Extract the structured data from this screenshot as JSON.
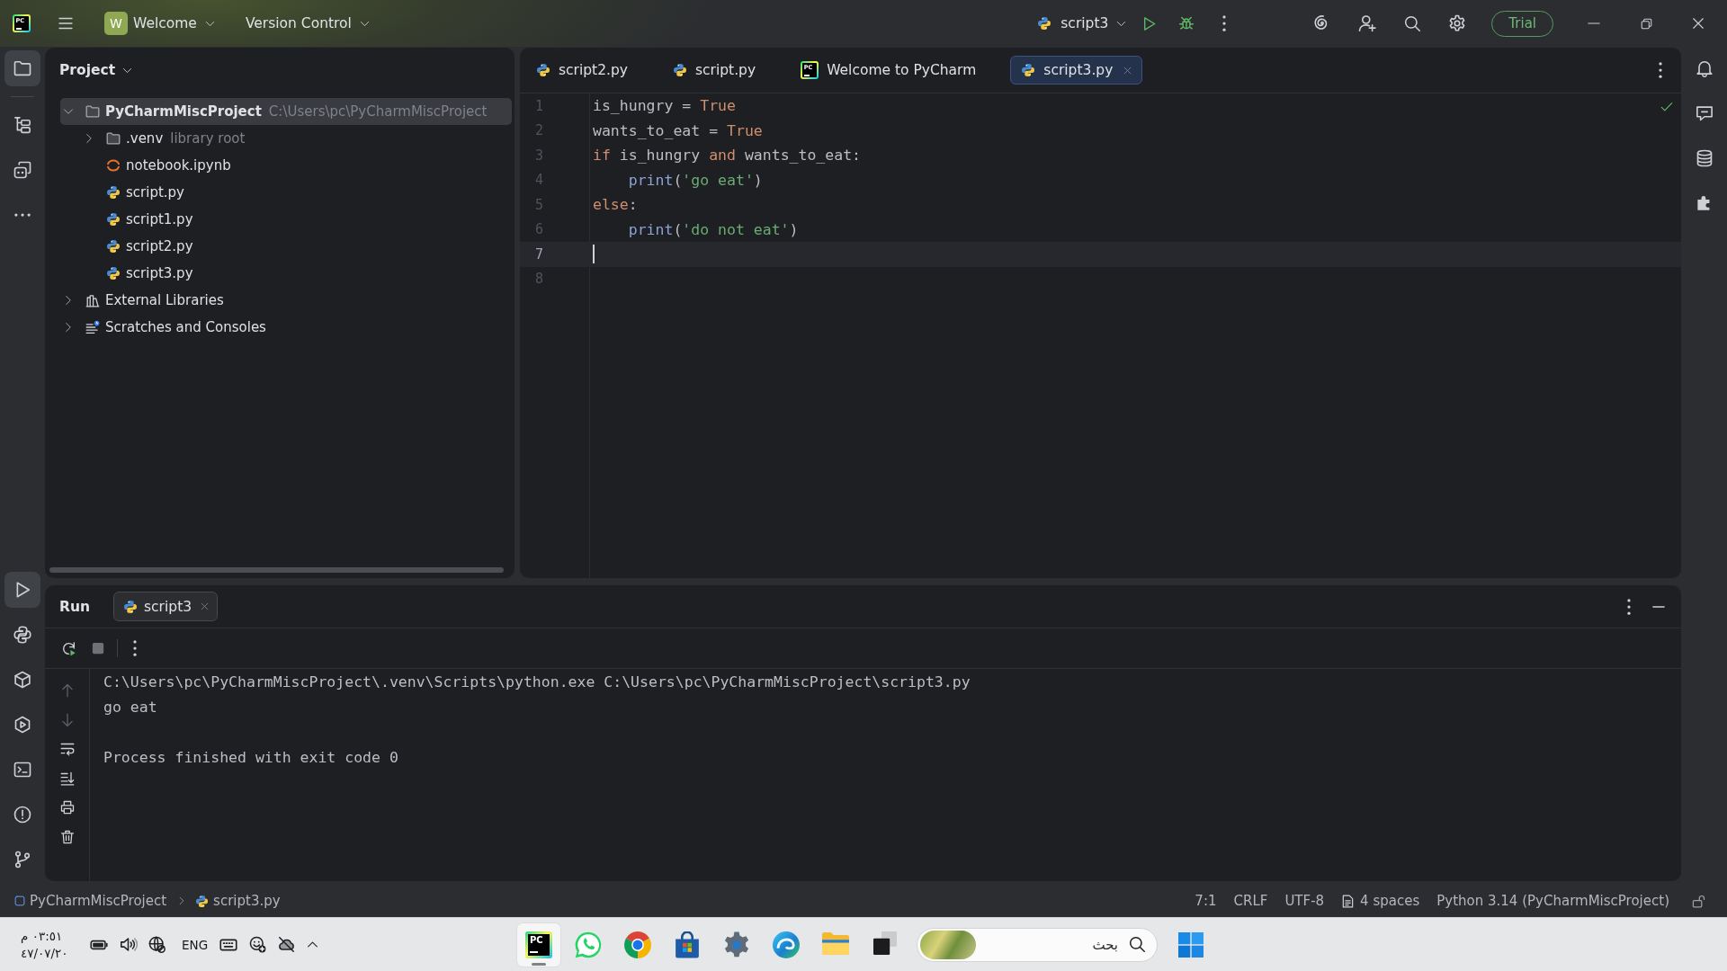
{
  "title_bar": {
    "logo": "PC",
    "project_badge": "W",
    "project": "Welcome",
    "vcs": "Version Control",
    "run_config": "script3",
    "trial": "Trial"
  },
  "tool_strip_left": {
    "top": [
      {
        "kind": "folder",
        "selected": true
      },
      {
        "kind": "structure",
        "selected": false
      },
      {
        "kind": "bot",
        "selected": false
      },
      {
        "kind": "more",
        "selected": false
      }
    ],
    "bottom": [
      {
        "kind": "run",
        "selected": true
      },
      {
        "kind": "python",
        "selected": false
      },
      {
        "kind": "packages",
        "selected": false
      },
      {
        "kind": "services",
        "selected": false
      },
      {
        "kind": "terminal",
        "selected": false
      },
      {
        "kind": "problems",
        "selected": false
      },
      {
        "kind": "git",
        "selected": false
      }
    ]
  },
  "project_panel": {
    "title": "Project",
    "tree": [
      {
        "kind": "folder",
        "label": "PyCharmMiscProject",
        "hint": "C:\\Users\\pc\\PyCharmMiscProject",
        "expanded": true,
        "selected": true,
        "children": [
          {
            "kind": "folder",
            "label": ".venv",
            "hint": "library root",
            "expanded": false,
            "selected": false
          },
          {
            "kind": "notebook",
            "label": "notebook.ipynb",
            "selected": false
          },
          {
            "kind": "python",
            "label": "script.py",
            "selected": false
          },
          {
            "kind": "python",
            "label": "script1.py",
            "selected": false
          },
          {
            "kind": "python",
            "label": "script2.py",
            "selected": false
          },
          {
            "kind": "python",
            "label": "script3.py",
            "selected": false
          }
        ]
      },
      {
        "kind": "libraries",
        "label": "External Libraries",
        "expanded": false,
        "selected": false
      },
      {
        "kind": "scratches",
        "label": "Scratches and Consoles",
        "expanded": false,
        "selected": false
      }
    ]
  },
  "editor": {
    "tabs": [
      {
        "kind": "python",
        "label": "script2.py",
        "selected": false
      },
      {
        "kind": "python",
        "label": "script.py",
        "selected": false
      },
      {
        "kind": "welcome",
        "logo": "PC",
        "label": "Welcome to PyCharm",
        "selected": false
      },
      {
        "kind": "python",
        "label": "script3.py",
        "selected": true
      }
    ],
    "lines": [
      {
        "number": "1",
        "current": false,
        "tokens": [
          {
            "kind": "plain",
            "text": "is_hungry = "
          },
          {
            "kind": "keyword",
            "text": "True"
          }
        ]
      },
      {
        "number": "2",
        "current": false,
        "tokens": [
          {
            "kind": "plain",
            "text": "wants_to_eat = "
          },
          {
            "kind": "keyword",
            "text": "True"
          }
        ]
      },
      {
        "number": "3",
        "current": false,
        "tokens": [
          {
            "kind": "keyword",
            "text": "if"
          },
          {
            "kind": "plain",
            "text": " is_hungry "
          },
          {
            "kind": "keyword",
            "text": "and"
          },
          {
            "kind": "plain",
            "text": " wants_to_eat:"
          }
        ]
      },
      {
        "number": "4",
        "current": false,
        "tokens": [
          {
            "kind": "builtin",
            "text": "    print"
          },
          {
            "kind": "plain",
            "text": "("
          },
          {
            "kind": "string",
            "text": "'go eat'"
          },
          {
            "kind": "plain",
            "text": ")"
          }
        ]
      },
      {
        "number": "5",
        "current": false,
        "tokens": [
          {
            "kind": "keyword",
            "text": "else"
          },
          {
            "kind": "plain",
            "text": ":"
          }
        ]
      },
      {
        "number": "6",
        "current": false,
        "tokens": [
          {
            "kind": "builtin",
            "text": "    print"
          },
          {
            "kind": "plain",
            "text": "("
          },
          {
            "kind": "string",
            "text": "'do not eat'"
          },
          {
            "kind": "plain",
            "text": ")"
          }
        ]
      },
      {
        "number": "7",
        "current": true
      },
      {
        "number": "8",
        "current": false
      }
    ]
  },
  "run_panel": {
    "title": "Run",
    "tabs": [
      {
        "label": "script3",
        "selected": true
      }
    ],
    "output": [
      {
        "kind": "text",
        "text": "C:\\Users\\pc\\PyCharmMiscProject\\.venv\\Scripts\\python.exe C:\\Users\\pc\\PyCharmMiscProject\\script3.py"
      },
      {
        "kind": "text",
        "text": "go eat"
      },
      {
        "kind": "status",
        "text": "Process finished with exit code 0"
      }
    ]
  },
  "status_bar": {
    "breadcrumbs": [
      {
        "kind": "project",
        "label": "PyCharmMiscProject"
      },
      {
        "kind": "python",
        "label": "script3.py"
      }
    ],
    "items": [
      {
        "kind": "text",
        "label": "7:1"
      },
      {
        "kind": "text",
        "label": "CRLF"
      },
      {
        "kind": "text",
        "label": "UTF-8"
      },
      {
        "kind": "indent",
        "label": "4 spaces"
      },
      {
        "kind": "text",
        "label": "Python 3.14 (PyCharmMiscProject)"
      }
    ]
  },
  "taskbar": {
    "time": "٠٣:٥١ م",
    "date": "٤٧/٠٧/٢٠",
    "language": "ENG",
    "apps": [
      {
        "kind": "pycharm",
        "logo": "PC",
        "running": true
      },
      {
        "kind": "whatsapp",
        "running": false
      },
      {
        "kind": "chrome",
        "running": false
      },
      {
        "kind": "store",
        "running": false
      },
      {
        "kind": "settings",
        "running": false
      },
      {
        "kind": "edge",
        "running": false
      },
      {
        "kind": "explorer",
        "running": false
      },
      {
        "kind": "window",
        "running": false
      }
    ],
    "search": {
      "placeholder": "بحث"
    }
  }
}
